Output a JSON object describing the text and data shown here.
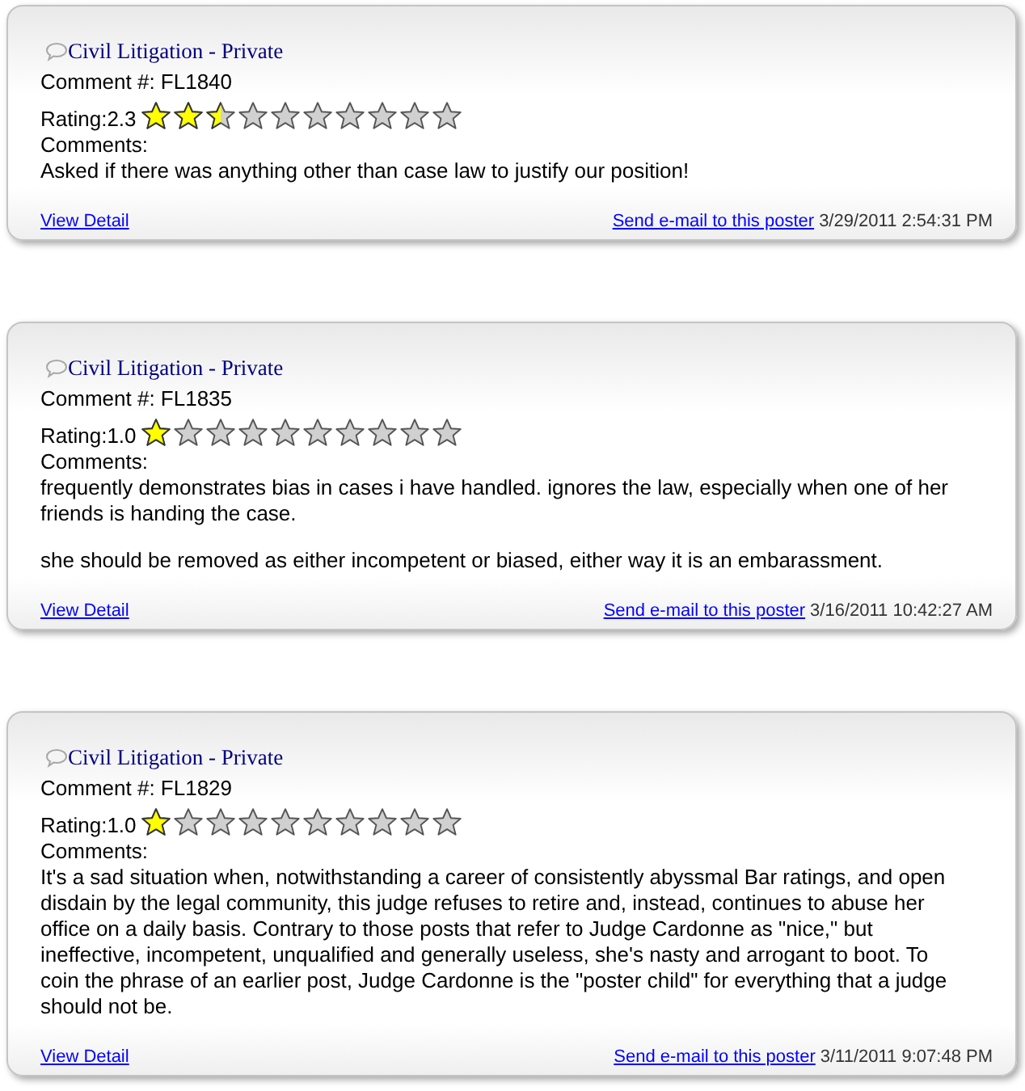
{
  "comments": [
    {
      "title": "Civil Litigation - Private",
      "comment_number": "Comment #: FL1840",
      "rating": "Rating:2.3",
      "stars": 2.3,
      "comments_label": "Comments:",
      "paragraphs": [
        "Asked if there was anything other than case law to justify our position!"
      ],
      "view_detail": "View Detail",
      "email_link": "Send e-mail to this poster",
      "date": "3/29/2011 2:54:31 PM"
    },
    {
      "title": "Civil Litigation - Private",
      "comment_number": "Comment #: FL1835",
      "rating": "Rating:1.0",
      "stars": 1,
      "comments_label": "Comments:",
      "paragraphs": [
        "frequently demonstrates bias in cases i have handled. ignores the law, especially when one of her friends is handing the case.",
        "she should be removed as either incompetent or biased, either way it is an embarassment."
      ],
      "view_detail": "View Detail",
      "email_link": "Send e-mail to this poster",
      "date": "3/16/2011 10:42:27 AM"
    },
    {
      "title": "Civil Litigation - Private",
      "comment_number": "Comment #: FL1829",
      "rating": "Rating:1.0",
      "stars": 1,
      "comments_label": "Comments:",
      "paragraphs": [
        "It's a sad situation when, notwithstanding a career of consistently abyssmal Bar ratings, and open disdain by the legal community, this judge refuses to retire and, instead, continues to abuse her office on a daily basis. Contrary to those posts that refer to Judge Cardonne as \"nice,\" but ineffective, incompetent, unqualified and generally useless, she's nasty and arrogant to boot. To coin the phrase of an earlier post, Judge Cardonne is the \"poster child\" for everything that a judge should not be."
      ],
      "view_detail": "View Detail",
      "email_link": "Send e-mail to this poster",
      "date": "3/11/2011 9:07:48 PM"
    }
  ]
}
